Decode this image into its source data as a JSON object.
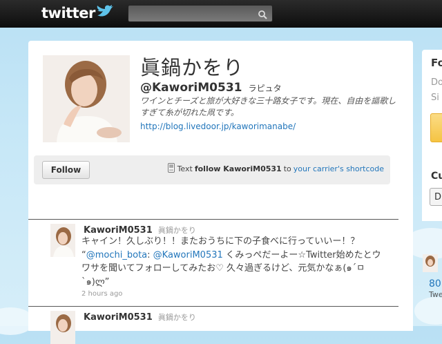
{
  "topbar": {
    "logo_text": "twitter",
    "search": {
      "value": "",
      "placeholder": ""
    }
  },
  "profile": {
    "name": "眞鍋かをり",
    "handle": "@KaworiM0531",
    "location": "ラピュタ",
    "bio": "ワインとチーズと旅が大好きな三十路女子です。現在、自由を謳歌しすぎて糸が切れた凧です。",
    "website": "http://blog.livedoor.jp/kaworimanabe/"
  },
  "actions": {
    "follow_label": "Follow",
    "sms_prefix": "Text",
    "sms_command": "follow KaworiM0531",
    "sms_to": "to",
    "sms_link": "your carrier's shortcode"
  },
  "tweets": [
    {
      "username": "KaworiM0531",
      "fullname": "眞鍋かをり",
      "text_part1": "キャイン！久しぶり！！またおうちに下の子食べに行っていいー！？ “",
      "mention1": "@mochi_bota",
      "text_part2": ": ",
      "mention2": "@KaworiM0531",
      "text_part3": " くみっぺだーよー☆Twitter始めたとウワサを聞いてフォローしてみたお♡ 久々過ぎるけど、元気かなぁ(๑´ㅁ`๑)ლ”",
      "time": "2 hours ago"
    },
    {
      "username": "KaworiM0531",
      "fullname": "眞鍋かをり"
    }
  ],
  "sidebar": {
    "heading": "Fo",
    "line1": "Do",
    "line2": "Si",
    "section2": "Cu",
    "button": "D",
    "count": "80",
    "count_label": "Twe"
  },
  "colors": {
    "link": "#2276bb",
    "topbar": "#111111",
    "background": "#c6e7f7"
  }
}
